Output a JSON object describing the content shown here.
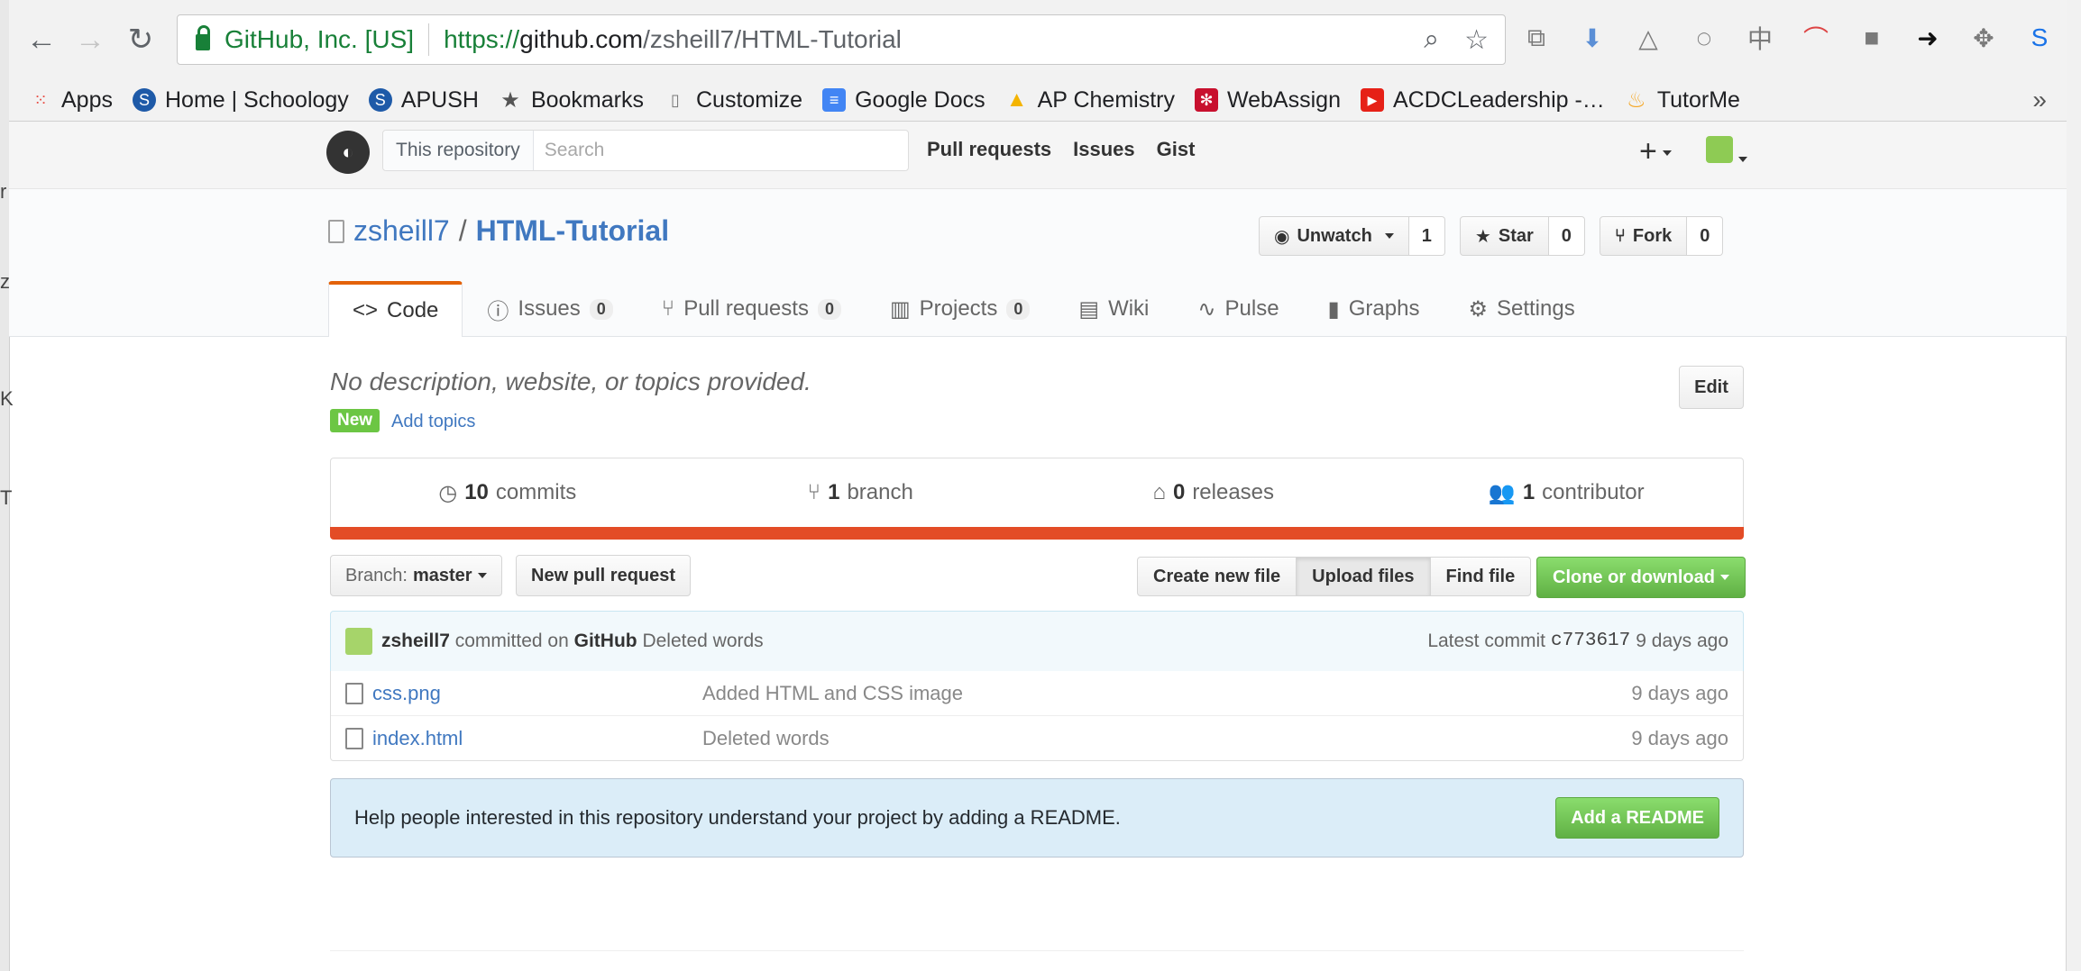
{
  "browser": {
    "secure_label": "GitHub, Inc. [US]",
    "url": {
      "protocol": "https://",
      "host": "github.com",
      "path": "/zsheill7/HTML-Tutorial"
    },
    "bookmarks": [
      {
        "label": "Apps",
        "icon": "apps-icon"
      },
      {
        "label": "Home | Schoology",
        "icon": "schoology-icon"
      },
      {
        "label": "APUSH",
        "icon": "schoology-icon"
      },
      {
        "label": "Bookmarks",
        "icon": "star-icon"
      },
      {
        "label": "Customize",
        "icon": "page-icon"
      },
      {
        "label": "Google Docs",
        "icon": "docs-icon"
      },
      {
        "label": "AP Chemistry",
        "icon": "drive-icon"
      },
      {
        "label": "WebAssign",
        "icon": "webassign-icon"
      },
      {
        "label": "ACDCLeadership -…",
        "icon": "youtube-icon"
      },
      {
        "label": "TutorMe",
        "icon": "tutorme-icon"
      }
    ]
  },
  "gh_header": {
    "search_scope": "This repository",
    "search_placeholder": "Search",
    "nav": [
      "Pull requests",
      "Issues",
      "Gist"
    ]
  },
  "repo": {
    "owner": "zsheill7",
    "separator": "/",
    "name": "HTML-Tutorial",
    "actions": [
      {
        "label": "Unwatch",
        "count": "1",
        "icon": "eye-icon"
      },
      {
        "label": "Star",
        "count": "0",
        "icon": "star-icon"
      },
      {
        "label": "Fork",
        "count": "0",
        "icon": "fork-icon"
      }
    ],
    "tabs": [
      {
        "label": "Code",
        "counter": "",
        "icon": "code-icon"
      },
      {
        "label": "Issues",
        "counter": "0",
        "icon": "issue-icon"
      },
      {
        "label": "Pull requests",
        "counter": "0",
        "icon": "pr-icon"
      },
      {
        "label": "Projects",
        "counter": "0",
        "icon": "project-icon"
      },
      {
        "label": "Wiki",
        "counter": "",
        "icon": "book-icon"
      },
      {
        "label": "Pulse",
        "counter": "",
        "icon": "pulse-icon"
      },
      {
        "label": "Graphs",
        "counter": "",
        "icon": "graph-icon"
      },
      {
        "label": "Settings",
        "counter": "",
        "icon": "gear-icon"
      }
    ]
  },
  "main": {
    "description": "No description, website, or topics provided.",
    "edit_label": "Edit",
    "new_badge": "New",
    "add_topics": "Add topics",
    "summary": [
      {
        "count": "10",
        "label": "commits"
      },
      {
        "count": "1",
        "label": "branch"
      },
      {
        "count": "0",
        "label": "releases"
      },
      {
        "count": "1",
        "label": "contributor"
      }
    ],
    "language_color": "#e34c26",
    "branch_prefix": "Branch:",
    "branch_name": "master",
    "new_pr": "New pull request",
    "file_buttons": [
      "Create new file",
      "Upload files",
      "Find file"
    ],
    "clone": "Clone or download",
    "commit": {
      "author": "zsheill7",
      "verb": "committed on",
      "platform": "GitHub",
      "message": "Deleted words",
      "latest_label": "Latest commit",
      "sha": "c773617",
      "age": "9 days ago"
    },
    "files": [
      {
        "name": "css.png",
        "message": "Added HTML and CSS image",
        "age": "9 days ago"
      },
      {
        "name": "index.html",
        "message": "Deleted words",
        "age": "9 days ago"
      }
    ],
    "readme_prompt": "Help people interested in this repository understand your project by adding a README.",
    "add_readme": "Add a README"
  }
}
